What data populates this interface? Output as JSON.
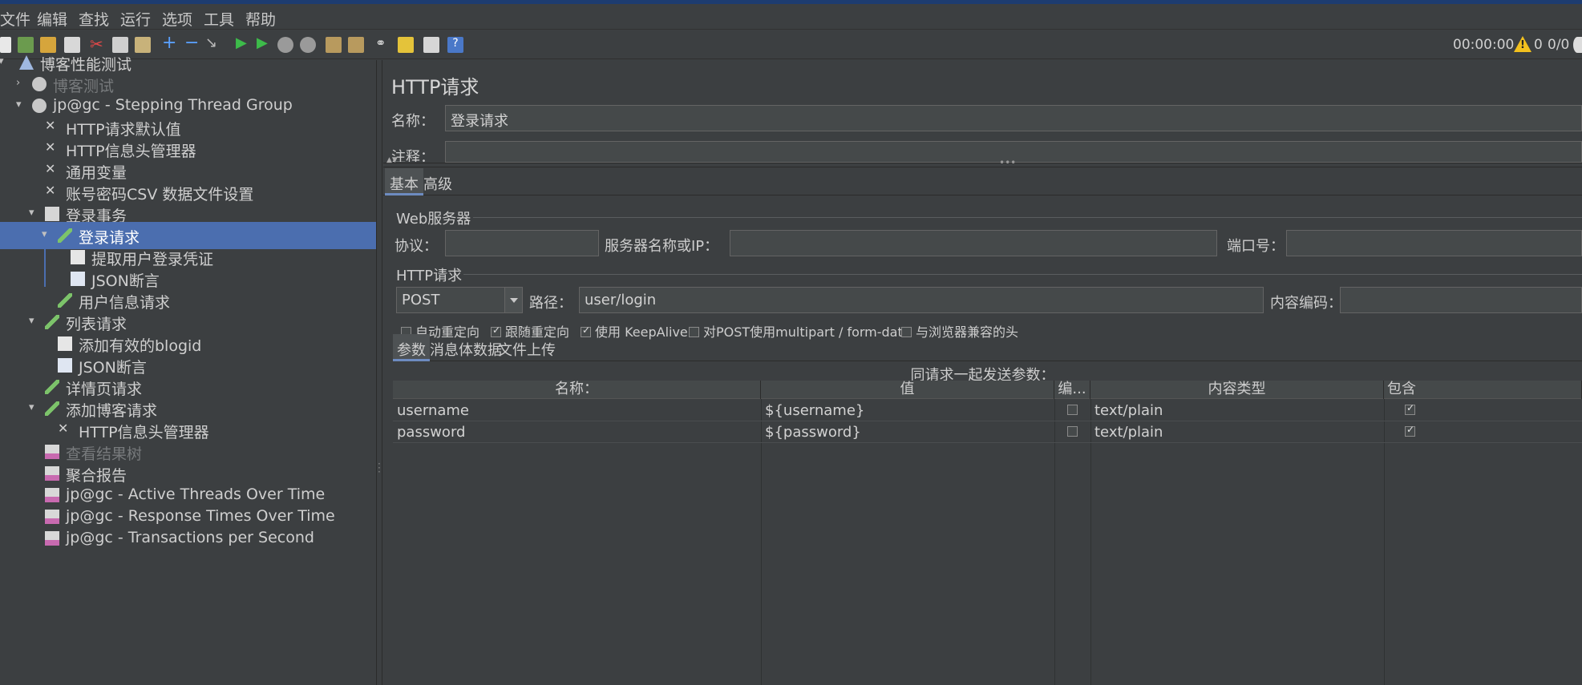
{
  "menu": [
    "文件",
    "编辑",
    "查找",
    "运行",
    "选项",
    "工具",
    "帮助"
  ],
  "toolbar": {
    "timer": "00:00:00",
    "warning_count": "0",
    "threads": "0/0",
    "icons": [
      "new-icon",
      "templates-icon",
      "open-icon",
      "save-icon",
      "cut-icon",
      "copy-icon",
      "paste-icon",
      "expand-icon",
      "collapse-icon",
      "toggle-icon",
      "start-icon",
      "start-no-pause-icon",
      "stop-icon",
      "shutdown-icon",
      "clear-icon",
      "clear-all-icon",
      "search-icon",
      "reset-search-icon",
      "function-helper-icon",
      "help-icon"
    ]
  },
  "tree": [
    {
      "label": "博客性能测试",
      "icon": "test-plan-icon",
      "arrow": "▾",
      "disabled": false
    },
    {
      "label": "博客测试",
      "icon": "thread-group-icon",
      "arrow": "›",
      "disabled": true
    },
    {
      "label": "jp@gc - Stepping Thread Group",
      "icon": "thread-group-icon",
      "arrow": "▾",
      "disabled": false
    },
    {
      "label": "HTTP请求默认值",
      "icon": "config-icon",
      "arrow": "",
      "disabled": false
    },
    {
      "label": "HTTP信息头管理器",
      "icon": "config-icon",
      "arrow": "",
      "disabled": false
    },
    {
      "label": "通用变量",
      "icon": "config-icon",
      "arrow": "",
      "disabled": false
    },
    {
      "label": "账号密码CSV 数据文件设置",
      "icon": "config-icon",
      "arrow": "",
      "disabled": false
    },
    {
      "label": "登录事务",
      "icon": "transaction-icon",
      "arrow": "▾",
      "disabled": false
    },
    {
      "label": "登录请求",
      "icon": "sampler-icon",
      "arrow": "▾",
      "disabled": false,
      "selected": true
    },
    {
      "label": "提取用户登录凭证",
      "icon": "extractor-icon",
      "arrow": "",
      "disabled": false
    },
    {
      "label": "JSON断言",
      "icon": "assertion-icon",
      "arrow": "",
      "disabled": false
    },
    {
      "label": "用户信息请求",
      "icon": "sampler-icon",
      "arrow": "",
      "disabled": false
    },
    {
      "label": "列表请求",
      "icon": "sampler-icon",
      "arrow": "▾",
      "disabled": false
    },
    {
      "label": "添加有效的blogid",
      "icon": "extractor-icon",
      "arrow": "",
      "disabled": false
    },
    {
      "label": "JSON断言",
      "icon": "assertion-icon",
      "arrow": "",
      "disabled": false
    },
    {
      "label": "详情页请求",
      "icon": "sampler-icon",
      "arrow": "",
      "disabled": false
    },
    {
      "label": "添加博客请求",
      "icon": "sampler-icon",
      "arrow": "▾",
      "disabled": false
    },
    {
      "label": "HTTP信息头管理器",
      "icon": "config-icon",
      "arrow": "",
      "disabled": false
    },
    {
      "label": "查看结果树",
      "icon": "listener-icon",
      "arrow": "",
      "disabled": true
    },
    {
      "label": "聚合报告",
      "icon": "listener-icon",
      "arrow": "",
      "disabled": false
    },
    {
      "label": "jp@gc - Active Threads Over Time",
      "icon": "listener-icon",
      "arrow": "",
      "disabled": false
    },
    {
      "label": "jp@gc - Response Times Over Time",
      "icon": "listener-icon",
      "arrow": "",
      "disabled": false
    },
    {
      "label": "jp@gc - Transactions per Second",
      "icon": "listener-icon",
      "arrow": "",
      "disabled": false
    }
  ],
  "panel": {
    "title": "HTTP请求",
    "name_label": "名称：",
    "name_value": "登录请求",
    "comment_label": "注释：",
    "tabs": [
      "基本",
      "高级"
    ],
    "web_server": {
      "title": "Web服务器",
      "protocol_label": "协议：",
      "protocol_value": "",
      "server_label": "服务器名称或IP：",
      "server_value": "",
      "port_label": "端口号：",
      "port_value": ""
    },
    "http_request": {
      "title": "HTTP请求",
      "method": "POST",
      "path_label": "路径：",
      "path_value": "user/login",
      "encoding_label": "内容编码：",
      "encoding_value": ""
    },
    "checkboxes": [
      {
        "label": "自动重定向",
        "checked": false
      },
      {
        "label": "跟随重定向",
        "checked": true
      },
      {
        "label": "使用 KeepAlive",
        "checked": true
      },
      {
        "label": "对POST使用multipart / form-data",
        "checked": false
      },
      {
        "label": "与浏览器兼容的头",
        "checked": false
      }
    ],
    "subtabs": [
      "参数",
      "消息体数据",
      "文件上传"
    ],
    "params_title": "同请求一起发送参数：",
    "columns": [
      "名称：",
      "值",
      "编...",
      "内容类型",
      "包含"
    ],
    "rows": [
      {
        "name": "username",
        "value": "${username}",
        "encode": false,
        "content_type": "text/plain",
        "include": true
      },
      {
        "name": "password",
        "value": "${password}",
        "encode": false,
        "content_type": "text/plain",
        "include": true
      }
    ]
  }
}
